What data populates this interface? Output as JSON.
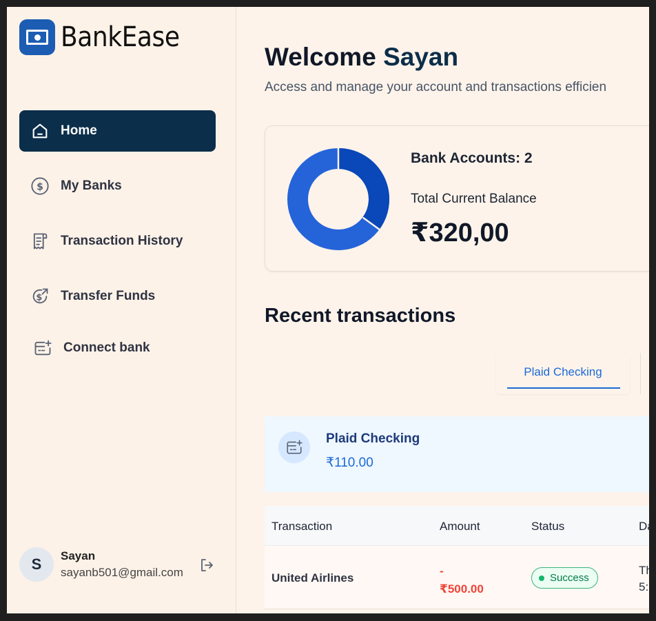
{
  "brand": {
    "name": "BankEase",
    "color": "#1c5db3"
  },
  "sidebar": {
    "items": [
      {
        "label": "Home",
        "icon": "home-icon",
        "active": true
      },
      {
        "label": "My Banks",
        "icon": "dollar-circle-icon"
      },
      {
        "label": "Transaction History",
        "icon": "receipt-icon"
      },
      {
        "label": "Transfer Funds",
        "icon": "money-send-icon"
      },
      {
        "label": "Connect bank",
        "icon": "connect-bank-icon"
      }
    ],
    "active_color": "#0b2e4a"
  },
  "user": {
    "initial": "S",
    "name": "Sayan",
    "email": "sayanb501@gmail.com"
  },
  "header": {
    "greeting": "Welcome",
    "username": "Sayan",
    "subtitle": "Access and manage your account and transactions efficien"
  },
  "balance_card": {
    "accounts_label": "Bank Accounts: 2",
    "balance_label": "Total Current Balance",
    "balance_value": "₹320,00",
    "donut_colors": [
      "#0a47b8",
      "#2563d9"
    ]
  },
  "recent": {
    "title": "Recent transactions",
    "tab_label": "Plaid Checking",
    "account": {
      "name": "Plaid Checking",
      "balance": "₹110.00"
    },
    "columns": [
      "Transaction",
      "Amount",
      "Status",
      "Da"
    ],
    "rows": [
      {
        "name": "United Airlines",
        "amount_sign": "-",
        "amount": "₹500.00",
        "status": "Success",
        "date_line1": "Th",
        "date_line2": "5:"
      }
    ]
  }
}
